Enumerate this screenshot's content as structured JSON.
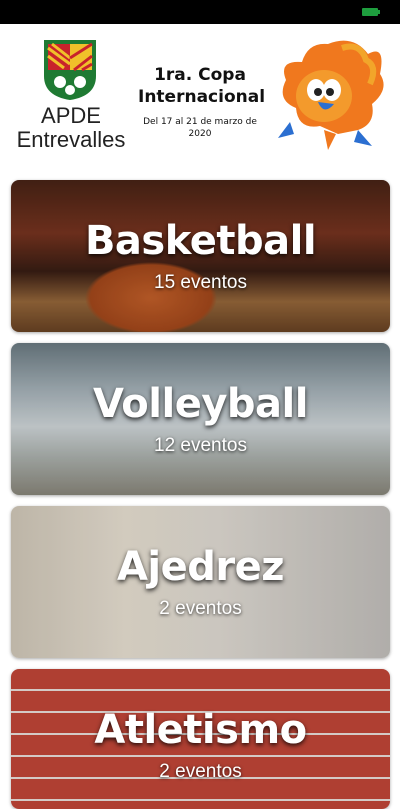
{
  "header": {
    "org_name": "APDE Entrevalles",
    "event_title": "1ra. Copa Internacional",
    "event_dates": "Del 17 al 21 de marzo de 2020"
  },
  "sports": [
    {
      "name": "Basketball",
      "count": "15 eventos"
    },
    {
      "name": "Volleyball",
      "count": "12 eventos"
    },
    {
      "name": "Ajedrez",
      "count": "2 eventos"
    },
    {
      "name": "Atletismo",
      "count": "2 eventos"
    }
  ],
  "icons": {
    "battery": "battery-icon",
    "shield": "coat-of-arms-icon",
    "mascot": "phoenix-mascot-icon"
  },
  "colors": {
    "battery": "#1e9e3e",
    "status_bar": "#000000",
    "card_text": "#ffffff"
  }
}
